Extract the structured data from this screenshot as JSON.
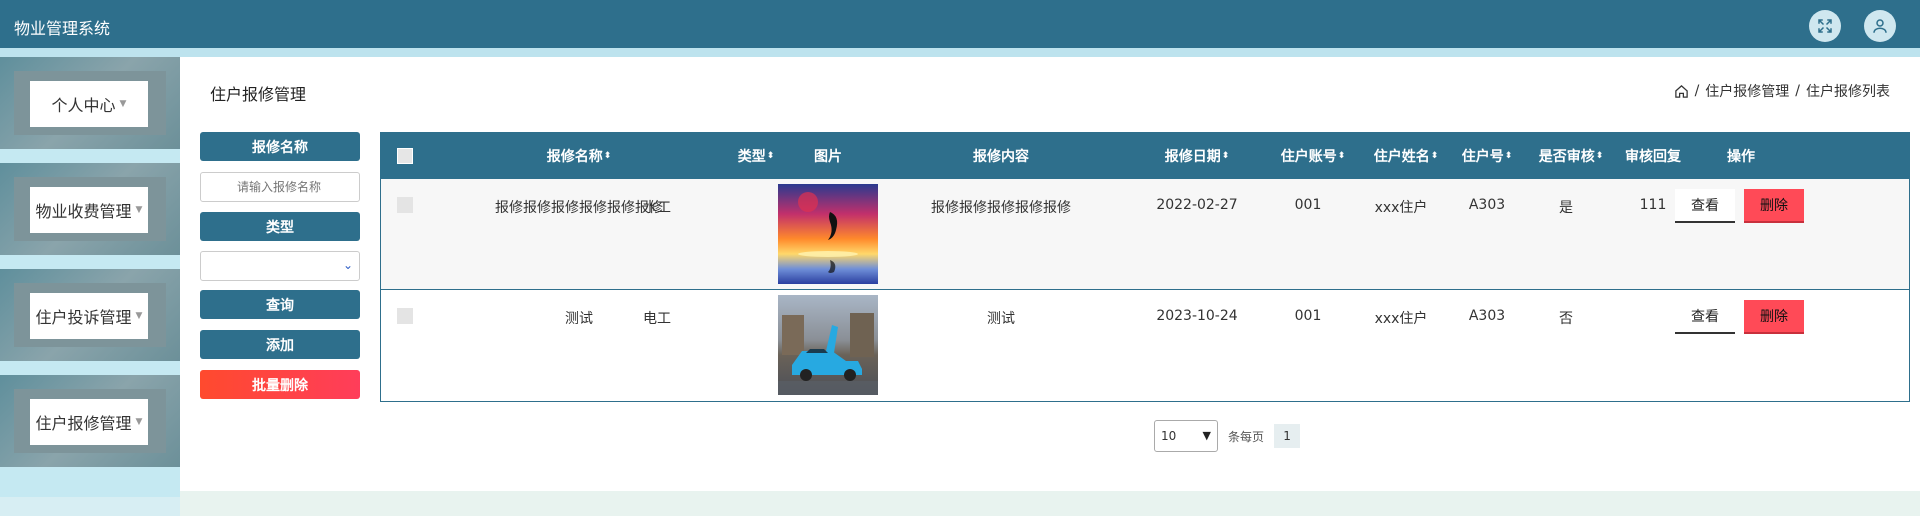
{
  "app": {
    "title": "物业管理系统"
  },
  "header_icons": [
    "fullscreen-icon",
    "user-icon"
  ],
  "sidebar": {
    "items": [
      {
        "label": "个人中心"
      },
      {
        "label": "物业收费管理"
      },
      {
        "label": "住户投诉管理"
      },
      {
        "label": "住户报修管理"
      }
    ]
  },
  "page": {
    "title": "住户报修管理",
    "breadcrumb": [
      "住户报修管理",
      "住户报修列表"
    ]
  },
  "filters": {
    "name_label": "报修名称",
    "name_placeholder": "请输入报修名称",
    "type_label": "类型",
    "type_value": "",
    "query_button": "查询",
    "add_button": "添加",
    "batch_delete_button": "批量删除"
  },
  "table": {
    "columns": [
      "报修名称",
      "类型",
      "图片",
      "报修内容",
      "报修日期",
      "住户账号",
      "住户姓名",
      "住户号",
      "是否审核",
      "审核回复",
      "操作"
    ],
    "sortable": [
      true,
      true,
      false,
      false,
      true,
      true,
      true,
      true,
      true,
      false,
      false
    ],
    "rows": [
      {
        "name": "报修报修报修报修报修报修",
        "type": "水工",
        "image": "dolphin-sunset",
        "content": "报修报修报修报修报修",
        "date": "2022-02-27",
        "account": "001",
        "resident_name": "xxx住户",
        "unit": "A303",
        "reviewed": "是",
        "reply": "111"
      },
      {
        "name": "测试",
        "type": "电工",
        "image": "blue-sports-car",
        "content": "测试",
        "date": "2023-10-24",
        "account": "001",
        "resident_name": "xxx住户",
        "unit": "A303",
        "reviewed": "否",
        "reply": ""
      }
    ],
    "view_label": "查看",
    "delete_label": "删除"
  },
  "pagination": {
    "page_size": "10",
    "per_page_label": "条每页",
    "current_page": "1"
  },
  "colors": {
    "primary": "#2e6f8c",
    "danger": "#ff4a57",
    "sidebar": "#c5e9f2"
  }
}
